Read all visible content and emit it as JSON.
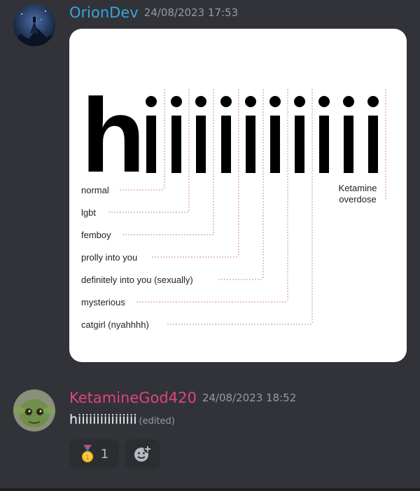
{
  "messages": [
    {
      "author": "OrionDev",
      "author_color": "#3ba3dd",
      "timestamp": "24/08/2023 17:53",
      "attachment": {
        "big_h": "h",
        "labels": [
          "normal",
          "lgbt",
          "femboy",
          "prolly into you",
          "definitely into you (sexually)",
          "mysterious",
          "catgirl (nyahhhh)"
        ],
        "right_label": [
          "Ketamine",
          "overdose"
        ]
      }
    },
    {
      "author": "KetamineGod420",
      "author_color": "#e0447c",
      "timestamp": "24/08/2023 18:52",
      "text": "hiiiiiiiiiiiiiiii",
      "edited_label": "(edited)",
      "reactions": [
        {
          "emoji": "gold-medal-icon",
          "count": "1"
        }
      ]
    }
  ]
}
